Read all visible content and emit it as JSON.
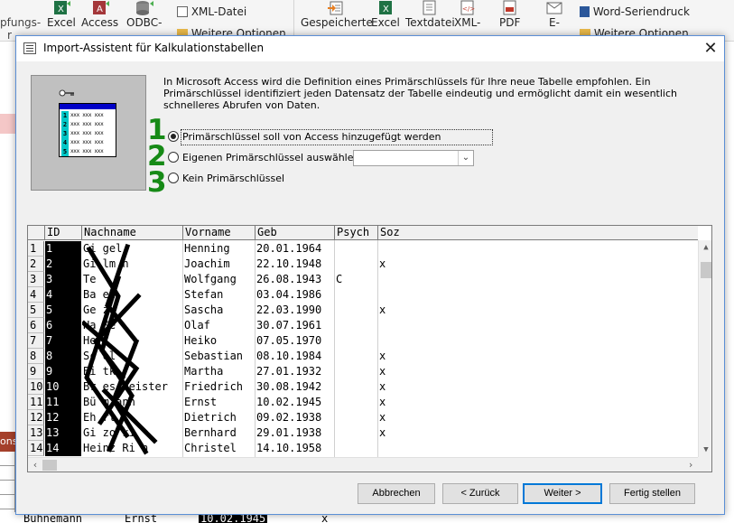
{
  "ribbon": {
    "cut_left": "pfungs-",
    "cut_left2": "r",
    "import_items": [
      {
        "label": "Excel",
        "sub": "",
        "icon": "excel-icon"
      },
      {
        "label": "Access",
        "sub": "",
        "icon": "access-icon"
      },
      {
        "label": "ODBC-",
        "sub": "",
        "icon": "odbc-icon"
      }
    ],
    "xml_file": "XML-Datei",
    "more_options_left": "Weitere Optionen",
    "export_items": [
      {
        "label": "Gespeicherte",
        "icon": "saved-exports-icon"
      },
      {
        "label": "Excel",
        "icon": "excel-icon"
      },
      {
        "label": "Textdatei",
        "icon": "textfile-icon"
      },
      {
        "label": "XML-",
        "icon": "xml-icon"
      },
      {
        "label": "PDF",
        "icon": "pdf-icon"
      },
      {
        "label": "E-",
        "icon": "email-icon"
      }
    ],
    "word_merge": "Word-Seriendruck",
    "more_options_right": "Weitere Optionen"
  },
  "dialog": {
    "title": "Import-Assistent für Kalkulationstabellen",
    "description_lines": [
      "In Microsoft Access wird die Definition eines Primärschlüssels für Ihre neue Tabelle empfohlen. Ein",
      "Primärschlüssel identifiziert jeden Datensatz der Tabelle eindeutig und ermöglicht damit ein wesentlich",
      "schnelleres Abrufen von Daten."
    ],
    "options": [
      {
        "label": "Primärschlüssel soll von Access hinzugefügt werden",
        "checked": true
      },
      {
        "label": "Eigenen Primärschlüssel auswählen",
        "checked": false
      },
      {
        "label": "Kein Primärschlüssel",
        "checked": false
      }
    ],
    "combo_value": "",
    "step_numbers": [
      "1",
      "2",
      "3"
    ],
    "picture_rows": [
      "1",
      "2",
      "3",
      "4",
      "5"
    ],
    "picture_text": "xxx xxx xxx",
    "buttons": {
      "cancel": "Abbrechen",
      "back": "< Zurück",
      "next": "Weiter >",
      "finish": "Fertig stellen"
    }
  },
  "grid": {
    "columns": [
      "ID",
      "Nachname",
      "Vorname",
      "Geb",
      "Psych",
      "Soz"
    ],
    "rows": [
      {
        "n": "1",
        "id": "1",
        "nachname": "Gi  gel",
        "vorname": "Henning",
        "geb": "20.01.1964",
        "psych": "",
        "soz": ""
      },
      {
        "n": "2",
        "id": "2",
        "nachname": "Gi  lm  n",
        "vorname": "Joachim",
        "geb": "22.10.1948",
        "psych": "",
        "soz": "x"
      },
      {
        "n": "3",
        "id": "3",
        "nachname": "Te",
        "vorname": "Wolfgang",
        "geb": "26.08.1943",
        "psych": "C",
        "soz": ""
      },
      {
        "n": "4",
        "id": "4",
        "nachname": "Ba  el",
        "vorname": "Stefan",
        "geb": "03.04.1986",
        "psych": "",
        "soz": ""
      },
      {
        "n": "5",
        "id": "5",
        "nachname": "Ge  z",
        "vorname": "Sascha",
        "geb": "22.03.1990",
        "psych": "",
        "soz": "x"
      },
      {
        "n": "6",
        "id": "6",
        "nachname": "Ha  ße",
        "vorname": "Olaf",
        "geb": "30.07.1961",
        "psych": "",
        "soz": ""
      },
      {
        "n": "7",
        "id": "7",
        "nachname": "He",
        "vorname": "Heiko",
        "geb": "07.05.1970",
        "psych": "",
        "soz": ""
      },
      {
        "n": "8",
        "id": "8",
        "nachname": "Sc  ol",
        "vorname": "Sebastian",
        "geb": "08.10.1984",
        "psych": "",
        "soz": "x"
      },
      {
        "n": "9",
        "id": "9",
        "nachname": "Bi  tk",
        "vorname": "Martha",
        "geb": "27.01.1932",
        "psych": "",
        "soz": "x"
      },
      {
        "n": "10",
        "id": "10",
        "nachname": "Br  es  meister",
        "vorname": "Friedrich",
        "geb": "30.08.1942",
        "psych": "",
        "soz": "x"
      },
      {
        "n": "11",
        "id": "11",
        "nachname": "Bü  m  ann",
        "vorname": "Ernst",
        "geb": "10.02.1945",
        "psych": "",
        "soz": "x"
      },
      {
        "n": "12",
        "id": "12",
        "nachname": "Eh  rt",
        "vorname": "Dietrich",
        "geb": "09.02.1938",
        "psych": "",
        "soz": "x"
      },
      {
        "n": "13",
        "id": "13",
        "nachname": "Gi  zo  ki",
        "vorname": "Bernhard",
        "geb": "29.01.1938",
        "psych": "",
        "soz": "x"
      },
      {
        "n": "14",
        "id": "14",
        "nachname": "Heinz  Ri  n",
        "vorname": "Christel",
        "geb": "14.10.1958",
        "psych": "",
        "soz": ""
      }
    ]
  },
  "background": {
    "bottom_row": [
      "Bühnemann",
      "Ernst",
      "10.02.1945",
      "x"
    ],
    "red_tab": "ons"
  },
  "colors": {
    "dialog_border": "#5b8fd6",
    "step_number": "#168a16",
    "primary_button": "#0078d7",
    "id_column_bg": "#000000"
  }
}
